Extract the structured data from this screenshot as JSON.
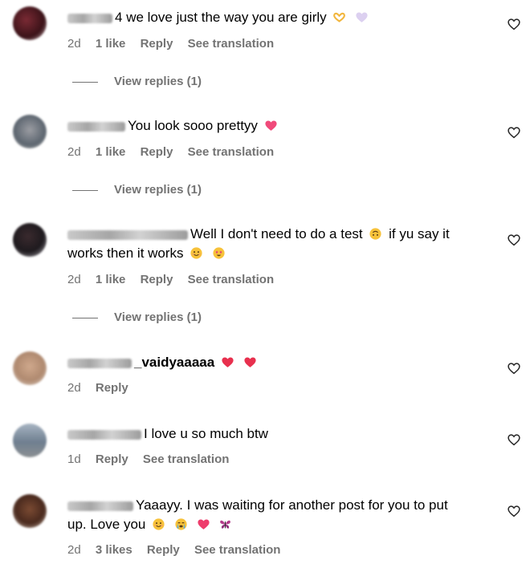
{
  "labels": {
    "reply": "Reply",
    "see_translation": "See translation"
  },
  "comments": [
    {
      "username_suffix": "4",
      "text": "we love just the way you are girly",
      "emojis": [
        "heart-hands-emoji",
        "white-heart-emoji"
      ],
      "time": "2d",
      "likes": "1 like",
      "show_translation": true,
      "view_replies": "View replies (1)"
    },
    {
      "username_suffix": "",
      "text": "You look sooo prettyy",
      "emojis": [
        "pink-heart-emoji"
      ],
      "time": "2d",
      "likes": "1 like",
      "show_translation": true,
      "view_replies": "View replies (1)"
    },
    {
      "username_suffix": "",
      "text_line1": "Well I don't need to do a test",
      "text_line1b": "if yu say it",
      "text_line2": "works then it works",
      "emojis": [
        "upside-down-face-emoji",
        "smiling-face-emoji",
        "star-struck-emoji"
      ],
      "time": "2d",
      "likes": "1 like",
      "show_translation": true,
      "view_replies": "View replies (1)"
    },
    {
      "username_suffix": "_vaidyaaaaa",
      "text": "",
      "emojis": [
        "red-heart-emoji",
        "red-heart-emoji"
      ],
      "time": "2d",
      "show_translation": false
    },
    {
      "username_suffix": "",
      "text": "I love u so much btw",
      "emojis": [],
      "time": "1d",
      "show_translation": true
    },
    {
      "username_suffix": "",
      "text_line1": "Yaaayy. I was waiting for another post for you to put",
      "text_line2": "up. Love you",
      "emojis": [
        "smiling-face-emoji",
        "crying-face-emoji",
        "heart-with-sparkle-emoji",
        "butterfly-emoji"
      ],
      "time": "2d",
      "likes": "3 likes",
      "show_translation": true
    }
  ],
  "colors": {
    "meta_text": "#737373",
    "text": "#000000",
    "background": "#ffffff"
  }
}
